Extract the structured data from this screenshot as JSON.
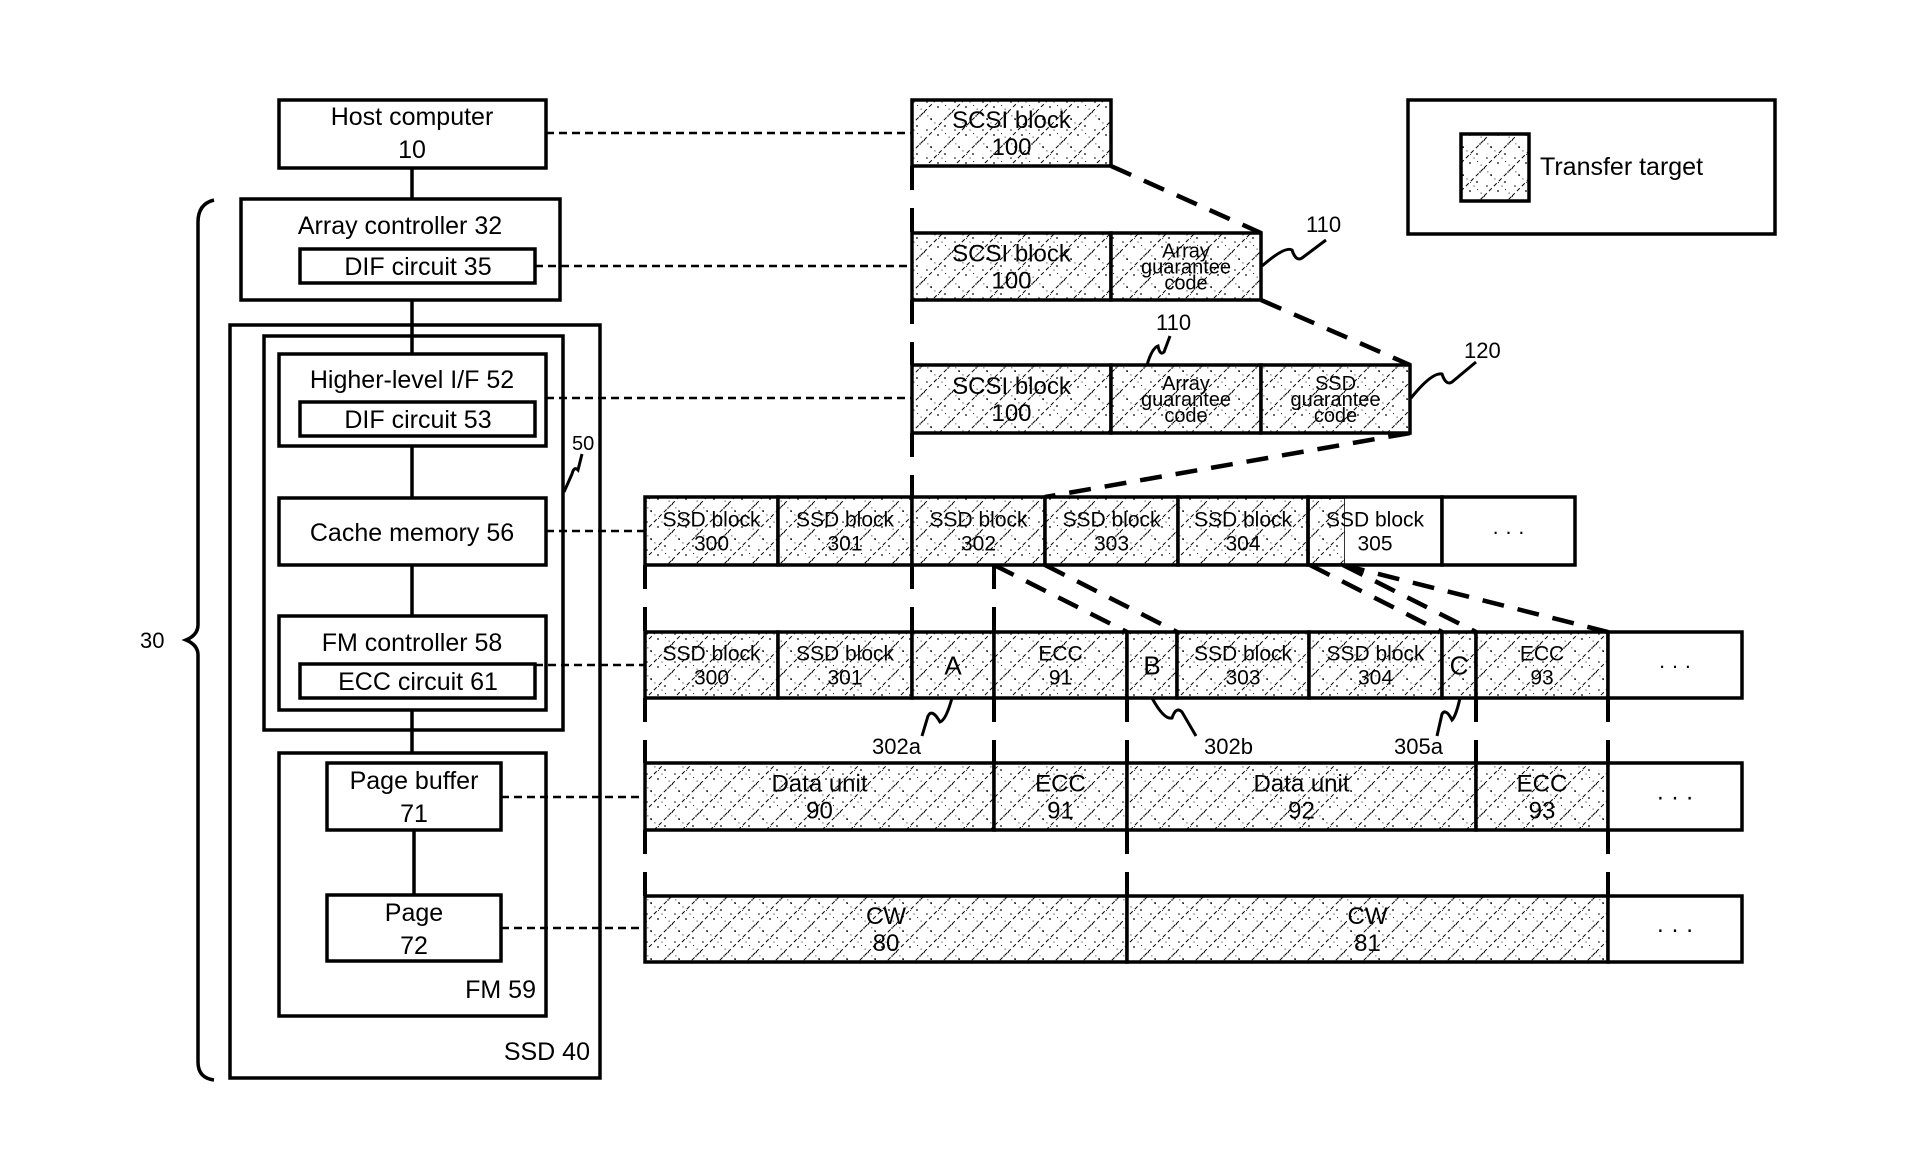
{
  "figure": {
    "kind": "patent block diagram",
    "colors": {
      "ink": "#000000",
      "paper": "#ffffff",
      "hatch": "#000000"
    }
  },
  "legend": {
    "swatch_icon": "hatched-square",
    "label": "Transfer target"
  },
  "hardware": {
    "host": {
      "line1": "Host computer",
      "line2": "10"
    },
    "array_controller": {
      "label": "Array controller 32",
      "dif": "DIF circuit  35"
    },
    "storage_system_ref": "30",
    "ssd": {
      "label": "SSD 40",
      "controller_ref": "50"
    },
    "higher_if": {
      "label": "Higher-level I/F 52",
      "dif": "DIF circuit  53"
    },
    "cache": {
      "label": "Cache memory 56"
    },
    "fm_controller": {
      "label": "FM controller 58",
      "ecc": "ECC circuit 61"
    },
    "fm": {
      "label": "FM 59"
    },
    "page_buffer": {
      "line1": "Page buffer",
      "line2": "71"
    },
    "page": {
      "line1": "Page",
      "line2": "72"
    }
  },
  "rows": {
    "scsi": {
      "cells": [
        {
          "lines": [
            "SCSI block",
            "100"
          ],
          "transfer_target": true
        }
      ]
    },
    "scsi_array": {
      "cells": [
        {
          "lines": [
            "SCSI block",
            "100"
          ],
          "transfer_target": true
        },
        {
          "lines": [
            "Array",
            "guarantee",
            "code"
          ],
          "transfer_target": true
        }
      ],
      "ref": "110"
    },
    "scsi_array_ssd": {
      "cells": [
        {
          "lines": [
            "SCSI block",
            "100"
          ],
          "transfer_target": true
        },
        {
          "lines": [
            "Array",
            "guarantee",
            "code"
          ],
          "transfer_target": true
        },
        {
          "lines": [
            "SSD",
            "guarantee",
            "code"
          ],
          "transfer_target": true
        }
      ],
      "refs": [
        "110",
        "120"
      ]
    },
    "cache_blocks": {
      "cells": [
        {
          "lines": [
            "SSD block",
            "300"
          ],
          "transfer_target": true
        },
        {
          "lines": [
            "SSD block",
            "301"
          ],
          "transfer_target": true
        },
        {
          "lines": [
            "SSD block",
            "302"
          ],
          "transfer_target": true
        },
        {
          "lines": [
            "SSD block",
            "303"
          ],
          "transfer_target": true
        },
        {
          "lines": [
            "SSD block",
            "304"
          ],
          "transfer_target": true
        },
        {
          "lines": [
            "SSD block",
            "305"
          ],
          "transfer_target": "partial"
        },
        {
          "lines": [
            "·  ·  ·"
          ],
          "transfer_target": false
        }
      ]
    },
    "fm_ctrl_blocks": {
      "cells": [
        {
          "lines": [
            "SSD block",
            "300"
          ],
          "transfer_target": true
        },
        {
          "lines": [
            "SSD block",
            "301"
          ],
          "transfer_target": true
        },
        {
          "lines": [
            "A"
          ],
          "transfer_target": true
        },
        {
          "lines": [
            "ECC",
            "91"
          ],
          "transfer_target": true
        },
        {
          "lines": [
            "B"
          ],
          "transfer_target": true
        },
        {
          "lines": [
            "SSD block",
            "303"
          ],
          "transfer_target": true
        },
        {
          "lines": [
            "SSD block",
            "304"
          ],
          "transfer_target": true
        },
        {
          "lines": [
            "C"
          ],
          "transfer_target": true
        },
        {
          "lines": [
            "ECC",
            "93"
          ],
          "transfer_target": true
        },
        {
          "lines": [
            "·  ·  ·"
          ],
          "transfer_target": false
        }
      ],
      "refs": [
        "302a",
        "302b",
        "305a"
      ]
    },
    "page_buffer_units": {
      "cells": [
        {
          "lines": [
            "Data unit",
            "90"
          ],
          "transfer_target": true
        },
        {
          "lines": [
            "ECC",
            "91"
          ],
          "transfer_target": true
        },
        {
          "lines": [
            "Data unit",
            "92"
          ],
          "transfer_target": true
        },
        {
          "lines": [
            "ECC",
            "93"
          ],
          "transfer_target": true
        },
        {
          "lines": [
            "·  ·  ·"
          ],
          "transfer_target": false
        }
      ]
    },
    "page_codewords": {
      "cells": [
        {
          "lines": [
            "CW",
            "80"
          ],
          "transfer_target": true
        },
        {
          "lines": [
            "CW",
            "81"
          ],
          "transfer_target": true
        },
        {
          "lines": [
            "·  ·  ·"
          ],
          "transfer_target": false
        }
      ]
    }
  }
}
